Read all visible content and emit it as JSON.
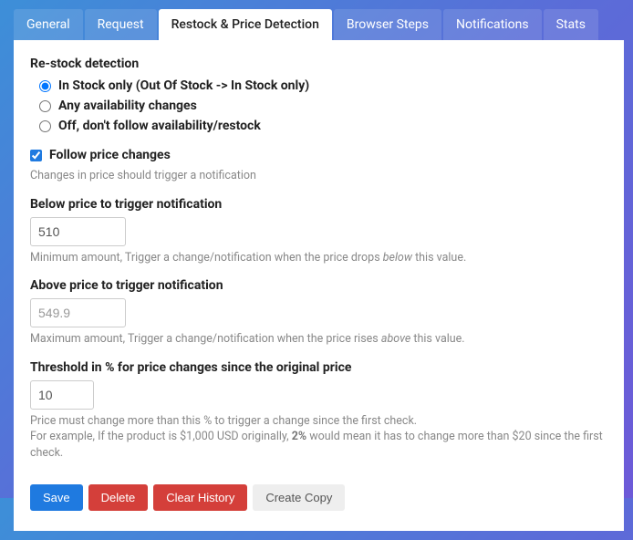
{
  "tabs": [
    {
      "label": "General"
    },
    {
      "label": "Request"
    },
    {
      "label": "Restock & Price Detection"
    },
    {
      "label": "Browser Steps"
    },
    {
      "label": "Notifications"
    },
    {
      "label": "Stats"
    }
  ],
  "restock": {
    "title": "Re-stock detection",
    "opt1": "In Stock only (Out Of Stock -> In Stock only)",
    "opt2": "Any availability changes",
    "opt3": "Off, don't follow availability/restock"
  },
  "follow": {
    "label": "Follow price changes",
    "help": "Changes in price should trigger a notification"
  },
  "below": {
    "label": "Below price to trigger notification",
    "value": "510",
    "help_pre": "Minimum amount, Trigger a change/notification when the price drops ",
    "help_em": "below",
    "help_post": " this value."
  },
  "above": {
    "label": "Above price to trigger notification",
    "placeholder": "549.9",
    "help_pre": "Maximum amount, Trigger a change/notification when the price rises ",
    "help_em": "above",
    "help_post": " this value."
  },
  "threshold": {
    "label": "Threshold in % for price changes since the original price",
    "value": "10",
    "help_line1": "Price must change more than this % to trigger a change since the first check.",
    "help_line2a": "For example, If the product is $1,000 USD originally, ",
    "help_line2_bold": "2%",
    "help_line2b": " would mean it has to change more than $20 since the first check."
  },
  "actions": {
    "save": "Save",
    "delete": "Delete",
    "clear": "Clear History",
    "copy": "Create Copy"
  }
}
